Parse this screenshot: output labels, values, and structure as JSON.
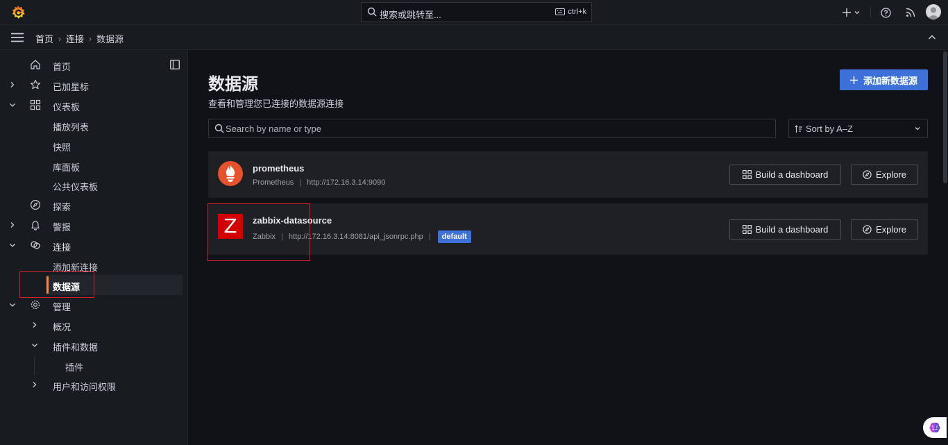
{
  "topbar": {
    "search_placeholder": "搜索或跳转至...",
    "shortcut": "ctrl+k",
    "icons": [
      "grafana-logo-icon",
      "plus-icon",
      "chevron-down-icon",
      "help-icon",
      "rss-icon",
      "user-avatar"
    ]
  },
  "breadcrumb": {
    "items": [
      "首页",
      "连接",
      "数据源"
    ]
  },
  "sidebar": {
    "items": [
      {
        "label": "首页",
        "icon": "home-icon"
      },
      {
        "label": "已加星标",
        "icon": "star-icon"
      },
      {
        "label": "仪表板",
        "icon": "apps-icon"
      },
      {
        "label": "播放列表"
      },
      {
        "label": "快照"
      },
      {
        "label": "库面板"
      },
      {
        "label": "公共仪表板"
      },
      {
        "label": "探索",
        "icon": "compass-icon"
      },
      {
        "label": "警报",
        "icon": "bell-icon"
      },
      {
        "label": "连接",
        "icon": "link-icon"
      },
      {
        "label": "添加新连接"
      },
      {
        "label": "数据源"
      },
      {
        "label": "管理",
        "icon": "cog-icon"
      },
      {
        "label": "概况"
      },
      {
        "label": "插件和数据"
      },
      {
        "label": "插件"
      },
      {
        "label": "用户和访问权限"
      }
    ]
  },
  "main": {
    "title": "数据源",
    "subtitle": "查看和管理您已连接的数据源连接",
    "add_button": "添加新数据源",
    "filter_placeholder": "Search by name or type",
    "sort_label": "Sort by A–Z",
    "datasources": [
      {
        "name": "prometheus",
        "type": "Prometheus",
        "url": "http://172.16.3.14:9090",
        "build_label": "Build a dashboard",
        "explore_label": "Explore"
      },
      {
        "name": "zabbix-datasource",
        "type": "Zabbix",
        "url": "http://172.16.3.14:8081/api_jsonrpc.php",
        "badge": "default",
        "logo_letter": "Z",
        "build_label": "Build a dashboard",
        "explore_label": "Explore"
      }
    ]
  },
  "colors": {
    "primary": "#3d71d9",
    "active_accent": "#ff8833",
    "highlight": "#d3212d",
    "prometheus": "#e6522c",
    "zabbix": "#d40000"
  }
}
